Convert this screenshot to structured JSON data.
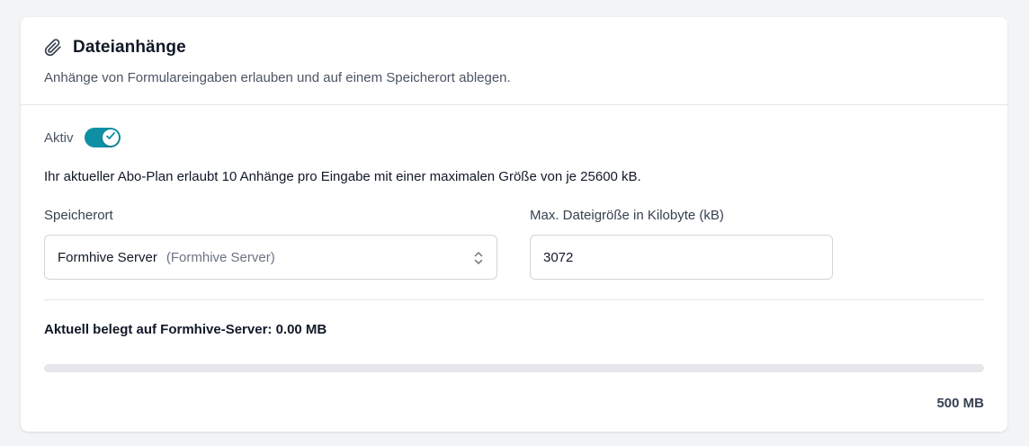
{
  "section": {
    "title": "Dateianhänge",
    "subtitle": "Anhänge von Formulareingaben erlauben und auf einem Speicherort ablegen.",
    "icon": "paperclip-icon"
  },
  "toggle": {
    "label": "Aktiv",
    "checked": true,
    "color": "#0e8fa3"
  },
  "plan_info": "Ihr aktueller Abo-Plan erlaubt 10 Anhänge pro Eingabe mit einer maximalen Größe von je 25600 kB.",
  "storage": {
    "label": "Speicherort",
    "value": "Formhive Server",
    "detail": "(Formhive Server)"
  },
  "max_size": {
    "label": "Max. Dateigröße in Kilobyte (kB)",
    "value": "3072"
  },
  "usage": {
    "text": "Aktuell belegt auf Formhive-Server: 0.00 MB",
    "fraction": 0.0,
    "max_label": "500 MB"
  }
}
